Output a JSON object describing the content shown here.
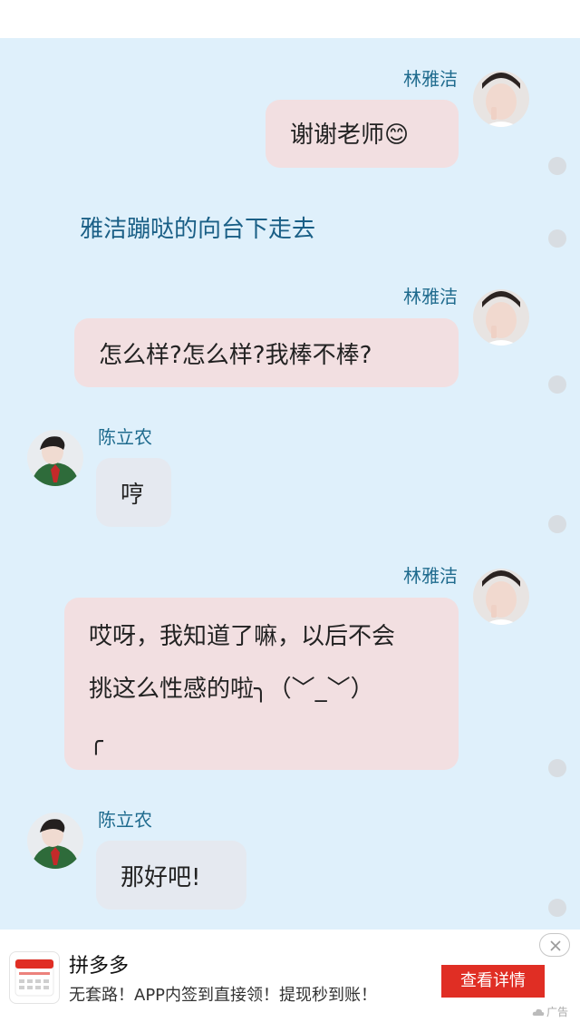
{
  "colors": {
    "chat_bg": "#dff0fb",
    "name_color": "#1f6b8e",
    "narration_color": "#1a5f86",
    "bubble_self": "#f2dfe1",
    "bubble_other": "#e5e9f0",
    "ad_button": "#e02e24"
  },
  "messages": [
    {
      "sender": "林雅洁",
      "text": "谢谢老师😊"
    },
    {
      "narration": "雅洁蹦哒的向台下走去"
    },
    {
      "sender": "林雅洁",
      "text": "怎么样?怎么样?我棒不棒?"
    },
    {
      "sender": "陈立农",
      "text": "哼"
    },
    {
      "sender": "林雅洁",
      "lines": [
        "哎呀，我知道了嘛，以后不会",
        "挑这么性感的啦╮（﹀_﹀）",
        "╭"
      ]
    },
    {
      "sender": "陈立农",
      "text": "那好吧!"
    }
  ],
  "ad": {
    "app_name": "拼多多",
    "description": "无套路！APP内签到直接领！提现秒到账！",
    "button_label": "查看详情",
    "ad_label": "广告",
    "icon": "pinduoduo-app-icon"
  }
}
